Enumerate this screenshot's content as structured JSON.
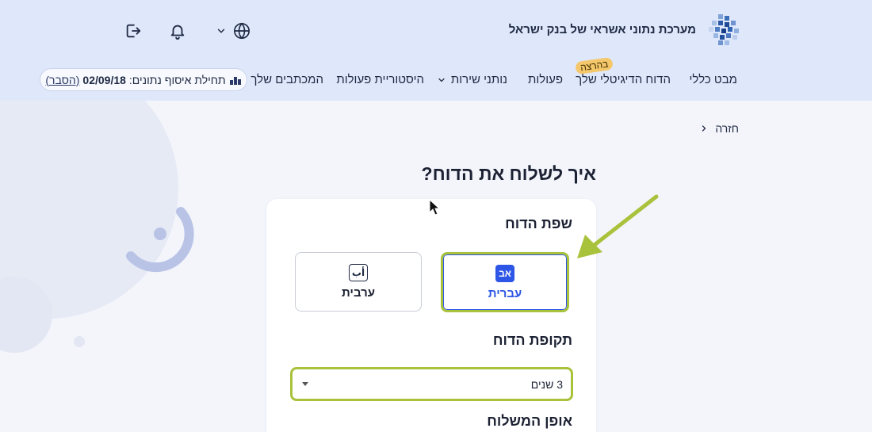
{
  "header": {
    "app_title": "מערכת נתוני אשראי של בנק ישראל",
    "icons": {
      "logo": "bank-of-israel-pixel-logo",
      "logout": "logout-icon",
      "notifications": "bell-icon",
      "language": "globe-icon",
      "language_dropdown": "chevron-down-icon"
    }
  },
  "nav": {
    "items": [
      {
        "label": "מבט כללי"
      },
      {
        "label": "הדוח הדיגיטלי שלך",
        "badge": "בהרצה"
      },
      {
        "label": "פעולות"
      },
      {
        "label": "נותני שירות",
        "has_dropdown": true
      },
      {
        "label": "היסטוריית פעולות"
      },
      {
        "label": "המכתבים שלך"
      }
    ]
  },
  "data_collection": {
    "label": "תחילת איסוף נתונים:",
    "date": "02/09/18",
    "explain_link": "(הסבר)"
  },
  "back_label": "חזרה",
  "page_title": "איך לשלוח את הדוח?",
  "report_language": {
    "title": "שפת הדוח",
    "options": [
      {
        "label": "עברית",
        "icon_text": "אב",
        "selected": true
      },
      {
        "label": "ערבית",
        "icon_text": "أب",
        "selected": false
      }
    ]
  },
  "report_period": {
    "title": "תקופת הדוח",
    "selected_value": "3 שנים"
  },
  "delivery_method": {
    "title": "אופן המשלוח"
  },
  "colors": {
    "header_bg": "#dfe8fb",
    "page_bg": "#f3f5fb",
    "accent_blue": "#2d55e6",
    "highlight_green": "#a9c23b",
    "badge_yellow": "#f5c76b"
  }
}
